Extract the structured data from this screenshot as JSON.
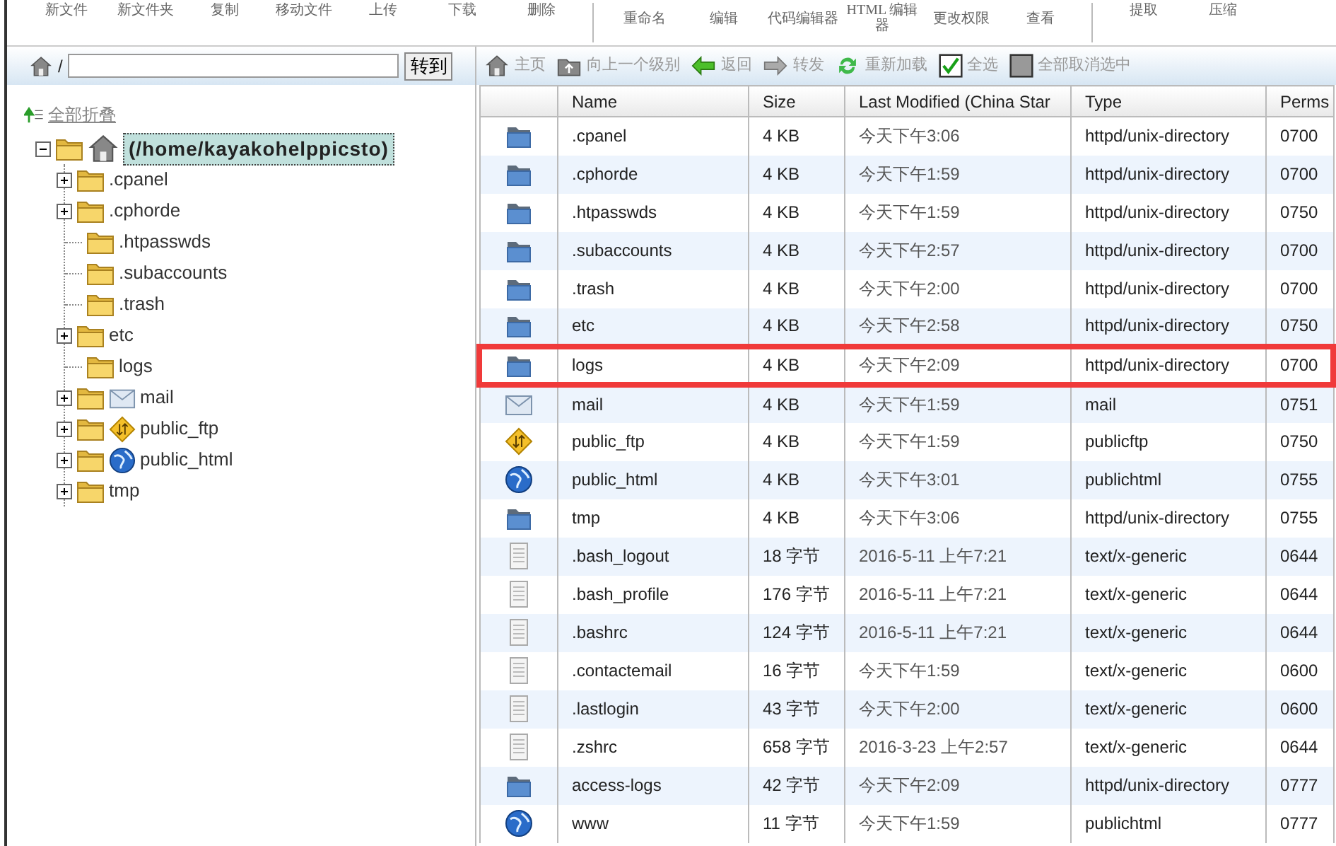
{
  "top_toolbar": {
    "groups": [
      [
        "新文件",
        "新文件夹",
        "复制",
        "移动文件",
        "上传",
        "下载",
        "删除"
      ],
      [
        "重命名",
        "编辑",
        "代码编辑器",
        "HTML 编辑器",
        "更改权限",
        "查看"
      ],
      [
        "提取",
        "压缩"
      ]
    ]
  },
  "path_bar": {
    "prefix": "/",
    "go_button": "转到"
  },
  "collapse_all": "全部折叠",
  "tree": {
    "label": "(/home/kayakohelppicsto)",
    "selected": true,
    "expanded": true,
    "children": [
      {
        "label": ".cpanel",
        "kind": "folder",
        "expandable": true
      },
      {
        "label": ".cphorde",
        "kind": "folder",
        "expandable": true
      },
      {
        "label": ".htpasswds",
        "kind": "folder",
        "expandable": false
      },
      {
        "label": ".subaccounts",
        "kind": "folder",
        "expandable": false
      },
      {
        "label": ".trash",
        "kind": "folder",
        "expandable": false
      },
      {
        "label": "etc",
        "kind": "folder",
        "expandable": true
      },
      {
        "label": "logs",
        "kind": "folder",
        "expandable": false
      },
      {
        "label": "mail",
        "kind": "mail",
        "expandable": true
      },
      {
        "label": "public_ftp",
        "kind": "ftp",
        "expandable": true
      },
      {
        "label": "public_html",
        "kind": "globe",
        "expandable": true
      },
      {
        "label": "tmp",
        "kind": "folder",
        "expandable": true
      }
    ]
  },
  "file_toolbar": [
    {
      "label": "主页",
      "kind": "home"
    },
    {
      "label": "向上一个级别",
      "kind": "up"
    },
    {
      "label": "返回",
      "kind": "back"
    },
    {
      "label": "转发",
      "kind": "forward"
    },
    {
      "label": "重新加载",
      "kind": "reload"
    },
    {
      "label": "全选",
      "kind": "check",
      "checked": true
    },
    {
      "label": "全部取消选中",
      "kind": "check",
      "checked": false
    }
  ],
  "table": {
    "columns": [
      "Name",
      "Size",
      "Last Modified (China Star",
      "Type",
      "Perms"
    ],
    "rows": [
      {
        "kind": "folder",
        "name": ".cpanel",
        "size": "4 KB",
        "modified": "今天下午3:06",
        "type": "httpd/unix-directory",
        "perms": "0700",
        "highlighted": false
      },
      {
        "kind": "folder",
        "name": ".cphorde",
        "size": "4 KB",
        "modified": "今天下午1:59",
        "type": "httpd/unix-directory",
        "perms": "0700",
        "highlighted": false
      },
      {
        "kind": "folder",
        "name": ".htpasswds",
        "size": "4 KB",
        "modified": "今天下午1:59",
        "type": "httpd/unix-directory",
        "perms": "0750",
        "highlighted": false
      },
      {
        "kind": "folder",
        "name": ".subaccounts",
        "size": "4 KB",
        "modified": "今天下午2:57",
        "type": "httpd/unix-directory",
        "perms": "0700",
        "highlighted": false
      },
      {
        "kind": "folder",
        "name": ".trash",
        "size": "4 KB",
        "modified": "今天下午2:00",
        "type": "httpd/unix-directory",
        "perms": "0700",
        "highlighted": false
      },
      {
        "kind": "folder",
        "name": "etc",
        "size": "4 KB",
        "modified": "今天下午2:58",
        "type": "httpd/unix-directory",
        "perms": "0750",
        "highlighted": false
      },
      {
        "kind": "folder",
        "name": "logs",
        "size": "4 KB",
        "modified": "今天下午2:09",
        "type": "httpd/unix-directory",
        "perms": "0700",
        "highlighted": true
      },
      {
        "kind": "mail",
        "name": "mail",
        "size": "4 KB",
        "modified": "今天下午1:59",
        "type": "mail",
        "perms": "0751",
        "highlighted": false
      },
      {
        "kind": "ftp",
        "name": "public_ftp",
        "size": "4 KB",
        "modified": "今天下午1:59",
        "type": "publicftp",
        "perms": "0750",
        "highlighted": false
      },
      {
        "kind": "globe",
        "name": "public_html",
        "size": "4 KB",
        "modified": "今天下午3:01",
        "type": "publichtml",
        "perms": "0755",
        "highlighted": false
      },
      {
        "kind": "folder",
        "name": "tmp",
        "size": "4 KB",
        "modified": "今天下午3:06",
        "type": "httpd/unix-directory",
        "perms": "0755",
        "highlighted": false
      },
      {
        "kind": "file",
        "name": ".bash_logout",
        "size": "18 字节",
        "modified": "2016-5-11 上午7:21",
        "type": "text/x-generic",
        "perms": "0644",
        "highlighted": false
      },
      {
        "kind": "file",
        "name": ".bash_profile",
        "size": "176 字节",
        "modified": "2016-5-11 上午7:21",
        "type": "text/x-generic",
        "perms": "0644",
        "highlighted": false
      },
      {
        "kind": "file",
        "name": ".bashrc",
        "size": "124 字节",
        "modified": "2016-5-11 上午7:21",
        "type": "text/x-generic",
        "perms": "0644",
        "highlighted": false
      },
      {
        "kind": "file",
        "name": ".contactemail",
        "size": "16 字节",
        "modified": "今天下午1:59",
        "type": "text/x-generic",
        "perms": "0600",
        "highlighted": false
      },
      {
        "kind": "file",
        "name": ".lastlogin",
        "size": "43 字节",
        "modified": "今天下午2:00",
        "type": "text/x-generic",
        "perms": "0600",
        "highlighted": false
      },
      {
        "kind": "file",
        "name": ".zshrc",
        "size": "658 字节",
        "modified": "2016-3-23 上午2:57",
        "type": "text/x-generic",
        "perms": "0644",
        "highlighted": false
      },
      {
        "kind": "folder",
        "name": "access-logs",
        "size": "42 字节",
        "modified": "今天下午2:09",
        "type": "httpd/unix-directory",
        "perms": "0777",
        "highlighted": false
      },
      {
        "kind": "globe",
        "name": "www",
        "size": "11 字节",
        "modified": "今天下午1:59",
        "type": "publichtml",
        "perms": "0777",
        "highlighted": false
      }
    ]
  }
}
